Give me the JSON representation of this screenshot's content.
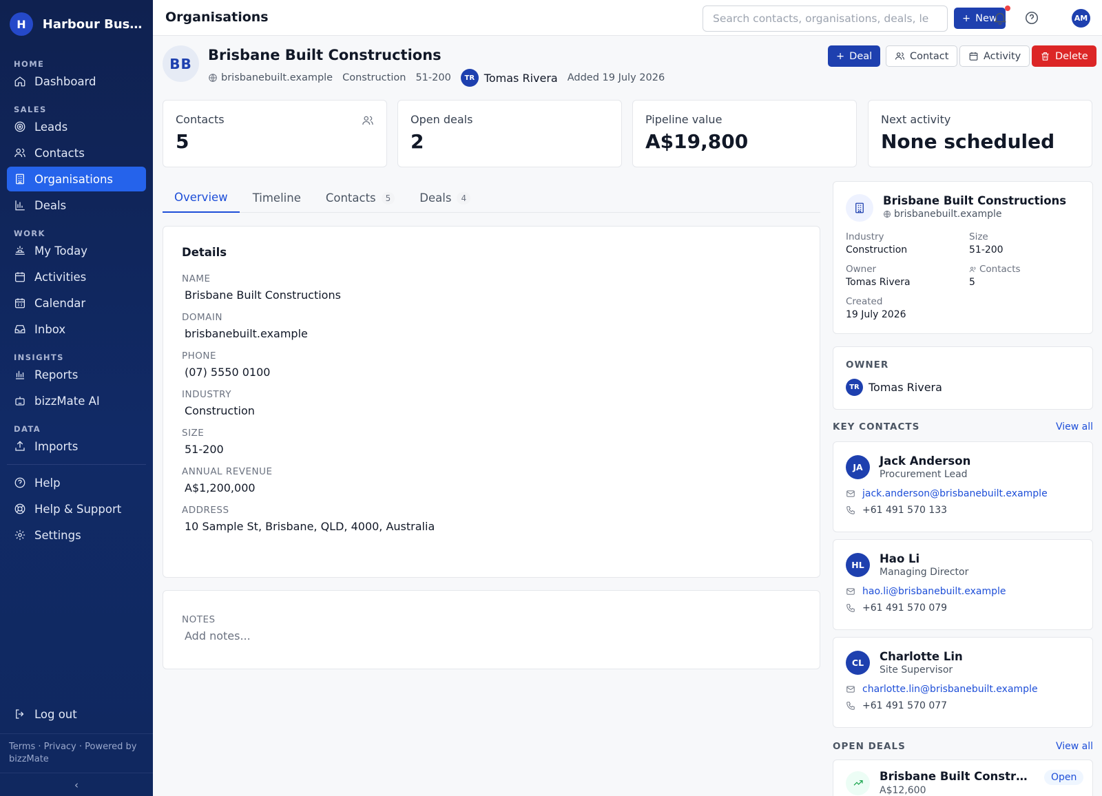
{
  "app": {
    "brand_initial": "H",
    "brand_name": "Harbour Bus..."
  },
  "sidebar": {
    "sections": [
      {
        "label": "HOME",
        "items": [
          {
            "label": "Dashboard",
            "icon": "home-icon"
          }
        ]
      },
      {
        "label": "SALES",
        "items": [
          {
            "label": "Leads",
            "icon": "target-icon"
          },
          {
            "label": "Contacts",
            "icon": "users-icon"
          },
          {
            "label": "Organisations",
            "icon": "building-icon",
            "active": true
          },
          {
            "label": "Deals",
            "icon": "bar-chart-icon"
          }
        ]
      },
      {
        "label": "WORK",
        "items": [
          {
            "label": "My Today",
            "icon": "sunrise-icon"
          },
          {
            "label": "Activities",
            "icon": "calendar-icon"
          },
          {
            "label": "Calendar",
            "icon": "calendar-grid-icon"
          },
          {
            "label": "Inbox",
            "icon": "inbox-icon"
          }
        ]
      },
      {
        "label": "INSIGHTS",
        "items": [
          {
            "label": "Reports",
            "icon": "reports-icon"
          },
          {
            "label": "bizzMate AI",
            "icon": "bot-icon"
          }
        ]
      },
      {
        "label": "DATA",
        "items": [
          {
            "label": "Imports",
            "icon": "upload-icon"
          }
        ]
      }
    ],
    "extra": [
      {
        "label": "Help",
        "icon": "help-circle-icon"
      },
      {
        "label": "Help & Support",
        "icon": "lifebuoy-icon"
      },
      {
        "label": "Settings",
        "icon": "gear-icon"
      }
    ],
    "logout": "Log out",
    "footer": "Terms · Privacy · Powered by bizzMate",
    "collapse_glyph": "‹"
  },
  "topbar": {
    "title": "Organisations",
    "search_placeholder": "Search contacts, organisations, deals, le",
    "new_label": "New",
    "user_initials": "AM"
  },
  "org": {
    "initials": "BB",
    "name": "Brisbane Built Constructions",
    "domain": "brisbanebuilt.example",
    "industry": "Construction",
    "size": "51-200",
    "owner_initials": "TR",
    "owner": "Tomas Rivera",
    "added": "Added 19 July 2026"
  },
  "actions": {
    "deal": "Deal",
    "contact": "Contact",
    "activity": "Activity",
    "delete": "Delete"
  },
  "stats": [
    {
      "label": "Contacts",
      "value": "5"
    },
    {
      "label": "Open deals",
      "value": "2"
    },
    {
      "label": "Pipeline value",
      "value": "A$19,800"
    },
    {
      "label": "Next activity",
      "value": "None scheduled"
    }
  ],
  "tabs": [
    {
      "label": "Overview",
      "count": ""
    },
    {
      "label": "Timeline",
      "count": ""
    },
    {
      "label": "Contacts",
      "count": "5"
    },
    {
      "label": "Deals",
      "count": "4"
    }
  ],
  "details": {
    "title": "Details",
    "fields": [
      {
        "label": "NAME",
        "value": "Brisbane Built Constructions"
      },
      {
        "label": "DOMAIN",
        "value": "brisbanebuilt.example"
      },
      {
        "label": "PHONE",
        "value": "(07) 5550 0100"
      },
      {
        "label": "INDUSTRY",
        "value": "Construction"
      },
      {
        "label": "SIZE",
        "value": "51-200"
      },
      {
        "label": "ANNUAL REVENUE",
        "value": "A$1,200,000"
      },
      {
        "label": "ADDRESS",
        "value": "10 Sample St, Brisbane, QLD, 4000, Australia"
      }
    ]
  },
  "notes": {
    "label": "NOTES",
    "placeholder": "Add notes..."
  },
  "summary": {
    "name": "Brisbane Built Constructions",
    "domain": "brisbanebuilt.example",
    "industry_label": "Industry",
    "industry": "Construction",
    "size_label": "Size",
    "size": "51-200",
    "owner_label": "Owner",
    "owner": "Tomas Rivera",
    "contacts_label": "Contacts",
    "contacts": "5",
    "created_label": "Created",
    "created": "19 July 2026"
  },
  "owner_card": {
    "label": "OWNER",
    "initials": "TR",
    "name": "Tomas Rivera"
  },
  "key_contacts": {
    "title": "KEY CONTACTS",
    "view_all": "View all",
    "items": [
      {
        "initials": "JA",
        "name": "Jack Anderson",
        "role": "Procurement Lead",
        "email": "jack.anderson@brisbanebuilt.example",
        "phone": "+61 491 570 133"
      },
      {
        "initials": "HL",
        "name": "Hao Li",
        "role": "Managing Director",
        "email": "hao.li@brisbanebuilt.example",
        "phone": "+61 491 570 079"
      },
      {
        "initials": "CL",
        "name": "Charlotte Lin",
        "role": "Site Supervisor",
        "email": "charlotte.lin@brisbanebuilt.example",
        "phone": "+61 491 570 077"
      }
    ]
  },
  "open_deals": {
    "title": "OPEN DEALS",
    "view_all": "View all",
    "items": [
      {
        "name": "Brisbane Built Construc...",
        "amount": "A$12,600",
        "status": "Open"
      }
    ]
  },
  "colors": {
    "sidebar_bg": "#0f2150",
    "accent": "#1e40af",
    "active_nav": "#2563eb",
    "danger": "#dc2626",
    "link": "#1d4ed8"
  }
}
